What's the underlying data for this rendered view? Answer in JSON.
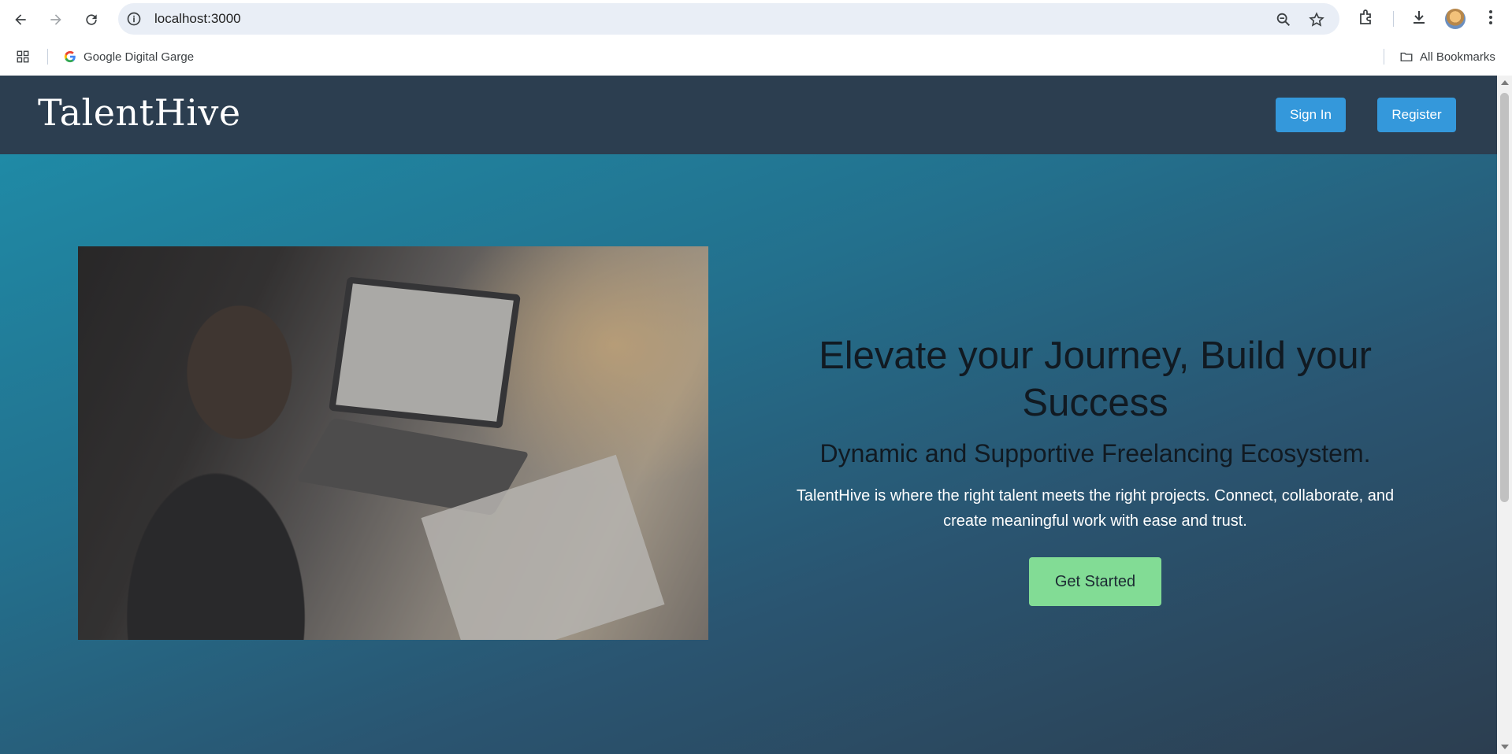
{
  "browser": {
    "url": "localhost:3000",
    "bookmarks_bar": {
      "items": [
        {
          "label": "Google Digital Garge",
          "icon": "google-icon"
        }
      ],
      "all_bookmarks_label": "All Bookmarks"
    }
  },
  "site": {
    "logo": "TalentHive",
    "nav": {
      "sign_in_label": "Sign In",
      "register_label": "Register"
    },
    "hero": {
      "title": "Elevate your Journey, Build your Success",
      "subtitle": "Dynamic and Supportive Freelancing Ecosystem.",
      "description": "TalentHive is where the right talent meets the right projects. Connect, collaborate, and create meaningful work with ease and trust.",
      "cta_label": "Get Started",
      "image_icon": "man-working-on-laptop-photo"
    }
  },
  "colors": {
    "header_bg": "#2c3e50",
    "nav_button": "#3498db",
    "cta_button": "#82dc95",
    "hero_gradient_start": "#1f8aa6",
    "hero_gradient_end": "#2c3e50"
  }
}
